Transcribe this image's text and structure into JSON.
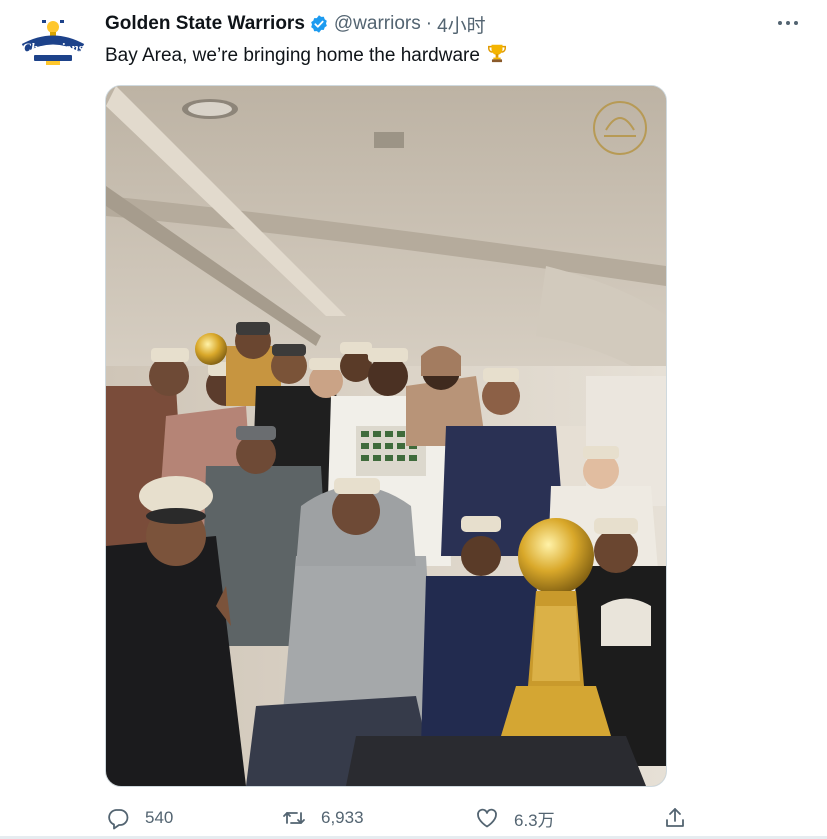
{
  "tweet": {
    "author": {
      "display_name": "Golden State Warriors",
      "handle": "@warriors",
      "verified": true,
      "avatar_icon": "champions-logo-icon",
      "avatar_text": "Champions"
    },
    "separator": "·",
    "timestamp": "4小时",
    "text": "Bay Area, we’re bringing home the hardware",
    "emoji_icon": "trophy-icon",
    "media": {
      "type": "photo",
      "icon": "photo-image"
    },
    "actions": {
      "reply": {
        "icon": "reply-icon",
        "count": "540"
      },
      "retweet": {
        "icon": "retweet-icon",
        "count": "6,933"
      },
      "like": {
        "icon": "heart-icon",
        "count": "6.3万"
      },
      "share": {
        "icon": "share-icon"
      }
    },
    "more_icon": "more-dots-icon"
  },
  "colors": {
    "text_primary": "#0f1419",
    "text_secondary": "#536471",
    "verified_blue": "#1d9bf0",
    "warriors_blue": "#1d428a",
    "warriors_gold": "#ffc72c"
  }
}
